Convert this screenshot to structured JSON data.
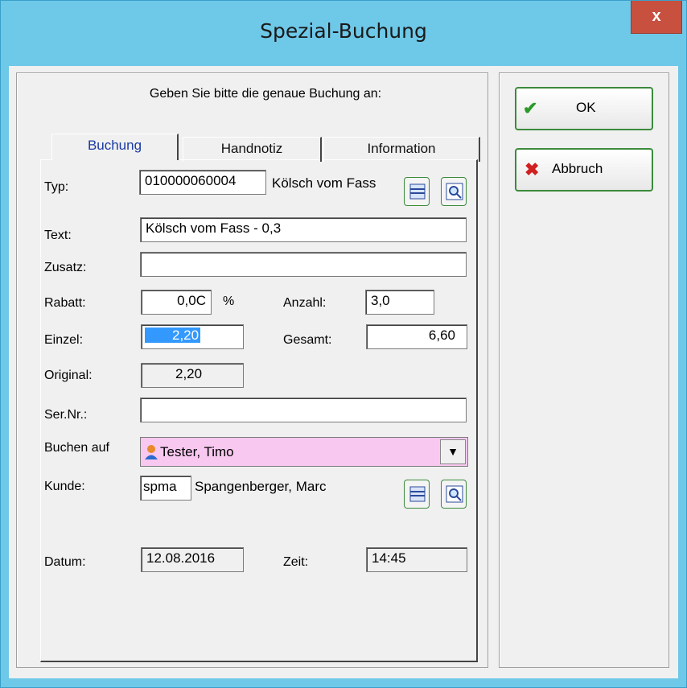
{
  "window": {
    "title": "Spezial-Buchung",
    "close_label": "x"
  },
  "instruction": "Geben Sie bitte die genaue Buchung an:",
  "tabs": [
    {
      "label": "Buchung",
      "active": true
    },
    {
      "label": "Handnotiz",
      "active": false
    },
    {
      "label": "Information",
      "active": false
    }
  ],
  "form": {
    "typ": {
      "label": "Typ:",
      "code": "010000060004",
      "name": "Kölsch vom Fass"
    },
    "text": {
      "label": "Text:",
      "value": "Kölsch vom Fass - 0,3"
    },
    "zusatz": {
      "label": "Zusatz:",
      "value": ""
    },
    "rabatt": {
      "label": "Rabatt:",
      "value": "0,0C",
      "unit": "%"
    },
    "anzahl": {
      "label": "Anzahl:",
      "value": "3,0"
    },
    "einzel": {
      "label": "Einzel:",
      "value": "2,20"
    },
    "gesamt": {
      "label": "Gesamt:",
      "value": "6,60"
    },
    "original": {
      "label": "Original:",
      "value": "2,20"
    },
    "sernr": {
      "label": "Ser.Nr.:",
      "value": ""
    },
    "buchen_auf": {
      "label": "Buchen auf",
      "value": "Tester, Timo"
    },
    "kunde": {
      "label": "Kunde:",
      "code": "spma",
      "name": "Spangenberger, Marc"
    },
    "datum": {
      "label": "Datum:",
      "value": "12.08.2016"
    },
    "zeit": {
      "label": "Zeit:",
      "value": "14:45"
    }
  },
  "buttons": {
    "ok": {
      "label": "OK",
      "icon": "checkmark-icon"
    },
    "abbruch": {
      "label": "Abbruch",
      "icon": "red-x-icon"
    }
  },
  "colors": {
    "title_bar": "#6ec8e8",
    "close": "#c7503f",
    "selected": "#3399ff",
    "combo": "#f8c8f0"
  }
}
